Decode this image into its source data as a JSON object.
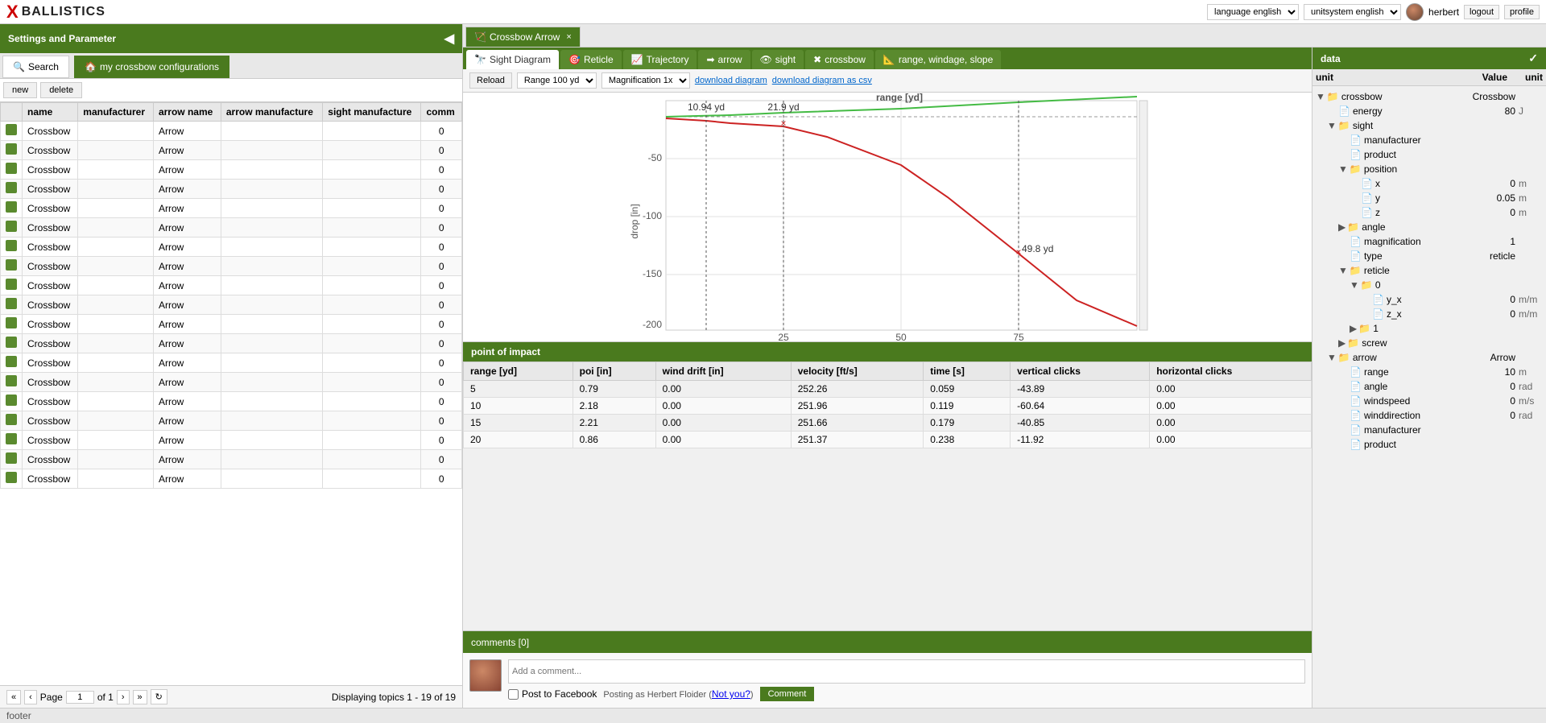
{
  "header": {
    "logo_x": "X",
    "logo_text": "BALLISTICS",
    "language_label": "language english",
    "unitsystem_label": "unitsystem english",
    "user": "herbert",
    "logout": "logout",
    "profile": "profile"
  },
  "left_panel": {
    "title": "Settings and Parameter",
    "collapse_icon": "◀",
    "tabs": [
      {
        "id": "search",
        "label": "Search",
        "icon": "🔍"
      },
      {
        "id": "my_configs",
        "label": "my crossbow configurations",
        "icon": "🏠"
      }
    ],
    "toolbar": {
      "new": "new",
      "delete": "delete"
    },
    "table": {
      "columns": [
        "name",
        "manufacturer",
        "arrow name",
        "arrow manufacture",
        "sight manufacture",
        "comm"
      ],
      "rows": [
        {
          "name": "Crossbow",
          "manufacturer": "",
          "arrow_name": "Arrow",
          "arrow_mfr": "",
          "sight_mfr": "",
          "comm": "0"
        },
        {
          "name": "Crossbow",
          "manufacturer": "",
          "arrow_name": "Arrow",
          "arrow_mfr": "",
          "sight_mfr": "",
          "comm": "0"
        },
        {
          "name": "Crossbow",
          "manufacturer": "",
          "arrow_name": "Arrow",
          "arrow_mfr": "",
          "sight_mfr": "",
          "comm": "0"
        },
        {
          "name": "Crossbow",
          "manufacturer": "",
          "arrow_name": "Arrow",
          "arrow_mfr": "",
          "sight_mfr": "",
          "comm": "0"
        },
        {
          "name": "Crossbow",
          "manufacturer": "",
          "arrow_name": "Arrow",
          "arrow_mfr": "",
          "sight_mfr": "",
          "comm": "0"
        },
        {
          "name": "Crossbow",
          "manufacturer": "",
          "arrow_name": "Arrow",
          "arrow_mfr": "",
          "sight_mfr": "",
          "comm": "0"
        },
        {
          "name": "Crossbow",
          "manufacturer": "",
          "arrow_name": "Arrow",
          "arrow_mfr": "",
          "sight_mfr": "",
          "comm": "0"
        },
        {
          "name": "Crossbow",
          "manufacturer": "",
          "arrow_name": "Arrow",
          "arrow_mfr": "",
          "sight_mfr": "",
          "comm": "0"
        },
        {
          "name": "Crossbow",
          "manufacturer": "",
          "arrow_name": "Arrow",
          "arrow_mfr": "",
          "sight_mfr": "",
          "comm": "0"
        },
        {
          "name": "Crossbow",
          "manufacturer": "",
          "arrow_name": "Arrow",
          "arrow_mfr": "",
          "sight_mfr": "",
          "comm": "0"
        },
        {
          "name": "Crossbow",
          "manufacturer": "",
          "arrow_name": "Arrow",
          "arrow_mfr": "",
          "sight_mfr": "",
          "comm": "0"
        },
        {
          "name": "Crossbow",
          "manufacturer": "",
          "arrow_name": "Arrow",
          "arrow_mfr": "",
          "sight_mfr": "",
          "comm": "0"
        },
        {
          "name": "Crossbow",
          "manufacturer": "",
          "arrow_name": "Arrow",
          "arrow_mfr": "",
          "sight_mfr": "",
          "comm": "0"
        },
        {
          "name": "Crossbow",
          "manufacturer": "",
          "arrow_name": "Arrow",
          "arrow_mfr": "",
          "sight_mfr": "",
          "comm": "0"
        },
        {
          "name": "Crossbow",
          "manufacturer": "",
          "arrow_name": "Arrow",
          "arrow_mfr": "",
          "sight_mfr": "",
          "comm": "0"
        },
        {
          "name": "Crossbow",
          "manufacturer": "",
          "arrow_name": "Arrow",
          "arrow_mfr": "",
          "sight_mfr": "",
          "comm": "0"
        },
        {
          "name": "Crossbow",
          "manufacturer": "",
          "arrow_name": "Arrow",
          "arrow_mfr": "",
          "sight_mfr": "",
          "comm": "0"
        },
        {
          "name": "Crossbow",
          "manufacturer": "",
          "arrow_name": "Arrow",
          "arrow_mfr": "",
          "sight_mfr": "",
          "comm": "0"
        },
        {
          "name": "Crossbow",
          "manufacturer": "",
          "arrow_name": "Arrow",
          "arrow_mfr": "",
          "sight_mfr": "",
          "comm": "0"
        }
      ]
    },
    "pagination": {
      "page_label": "Page",
      "page_current": "1",
      "page_of": "of 1",
      "displaying": "Displaying topics 1 - 19 of 19"
    }
  },
  "main_tab": {
    "label": "Crossbow Arrow",
    "close": "×",
    "icon": "🏹"
  },
  "sub_tabs": [
    {
      "id": "sight_diagram",
      "label": "Sight Diagram",
      "icon": "🔭",
      "active": true
    },
    {
      "id": "reticle",
      "label": "Reticle",
      "icon": "🎯"
    },
    {
      "id": "trajectory",
      "label": "Trajectory",
      "icon": "📈"
    },
    {
      "id": "arrow",
      "label": "arrow",
      "icon": "➡"
    },
    {
      "id": "sight",
      "label": "sight",
      "icon": "👁"
    },
    {
      "id": "crossbow",
      "label": "crossbow",
      "icon": "✖"
    },
    {
      "id": "range_windage",
      "label": "range, windage, slope",
      "icon": "📐"
    }
  ],
  "diagram_controls": {
    "reload": "Reload",
    "range_label": "Range 100 yd",
    "magnification_label": "Magnification 1x",
    "download_diagram": "download diagram",
    "download_csv": "download diagram as csv"
  },
  "chart": {
    "x_label": "range [yd]",
    "y_label": "drop [in]",
    "x_ticks": [
      25,
      50,
      75
    ],
    "y_ticks": [
      -50,
      -100,
      -150,
      -200
    ],
    "annotations": [
      {
        "x": "10.94 yd",
        "y": 0
      },
      {
        "x": "21.9 yd",
        "y": 0
      },
      {
        "x": "49.8 yd",
        "y": -30
      }
    ]
  },
  "poi": {
    "title": "point of impact",
    "columns": [
      "range [yd]",
      "poi [in]",
      "wind drift [in]",
      "velocity [ft/s]",
      "time [s]",
      "vertical clicks",
      "horizontal clicks"
    ],
    "rows": [
      {
        "range": "5",
        "poi": "0.79",
        "wind_drift": "0.00",
        "velocity": "252.26",
        "time": "0.059",
        "vert_clicks": "-43.89",
        "horiz_clicks": "0.00"
      },
      {
        "range": "10",
        "poi": "2.18",
        "wind_drift": "0.00",
        "velocity": "251.96",
        "time": "0.119",
        "vert_clicks": "-60.64",
        "horiz_clicks": "0.00"
      },
      {
        "range": "15",
        "poi": "2.21",
        "wind_drift": "0.00",
        "velocity": "251.66",
        "time": "0.179",
        "vert_clicks": "-40.85",
        "horiz_clicks": "0.00"
      },
      {
        "range": "20",
        "poi": "0.86",
        "wind_drift": "0.00",
        "velocity": "251.37",
        "time": "0.238",
        "vert_clicks": "-11.92",
        "horiz_clicks": "0.00"
      }
    ]
  },
  "comments": {
    "title": "comments [0]",
    "expand_icon": "✓",
    "placeholder": "Add a comment...",
    "facebook_label": "Post to Facebook",
    "posting_as": "Posting as Herbert Floider (",
    "not_you": "Not you?",
    "posting_end": ")",
    "comment_btn": "Comment"
  },
  "data_panel": {
    "title": "data",
    "expand_icon": "✓",
    "col_unit": "unit",
    "col_value": "Value",
    "col_unit2": "unit",
    "tree": [
      {
        "type": "folder",
        "label": "crossbow",
        "value": "Crossbow",
        "unit": "",
        "indent": 0,
        "open": true
      },
      {
        "type": "file",
        "label": "energy",
        "value": "80",
        "unit": "J",
        "indent": 1
      },
      {
        "type": "folder",
        "label": "sight",
        "value": "",
        "unit": "",
        "indent": 1,
        "open": true
      },
      {
        "type": "file",
        "label": "manufacturer",
        "value": "",
        "unit": "",
        "indent": 2
      },
      {
        "type": "file",
        "label": "product",
        "value": "",
        "unit": "",
        "indent": 2
      },
      {
        "type": "folder",
        "label": "position",
        "value": "",
        "unit": "",
        "indent": 2,
        "open": true
      },
      {
        "type": "file",
        "label": "x",
        "value": "0",
        "unit": "m",
        "indent": 3
      },
      {
        "type": "file",
        "label": "y",
        "value": "0.05",
        "unit": "m",
        "indent": 3
      },
      {
        "type": "file",
        "label": "z",
        "value": "0",
        "unit": "m",
        "indent": 3
      },
      {
        "type": "folder",
        "label": "angle",
        "value": "",
        "unit": "",
        "indent": 2,
        "open": false
      },
      {
        "type": "file",
        "label": "magnification",
        "value": "1",
        "unit": "",
        "indent": 2
      },
      {
        "type": "file",
        "label": "type",
        "value": "reticle",
        "unit": "",
        "indent": 2
      },
      {
        "type": "folder",
        "label": "reticle",
        "value": "",
        "unit": "",
        "indent": 2,
        "open": true
      },
      {
        "type": "folder",
        "label": "0",
        "value": "",
        "unit": "",
        "indent": 3,
        "open": true
      },
      {
        "type": "file",
        "label": "y_x",
        "value": "0",
        "unit": "m/m",
        "indent": 4
      },
      {
        "type": "file",
        "label": "z_x",
        "value": "0",
        "unit": "m/m",
        "indent": 4
      },
      {
        "type": "folder",
        "label": "1",
        "value": "",
        "unit": "",
        "indent": 3,
        "open": false
      },
      {
        "type": "folder",
        "label": "screw",
        "value": "",
        "unit": "",
        "indent": 2,
        "open": false
      },
      {
        "type": "folder",
        "label": "arrow",
        "value": "Arrow",
        "unit": "",
        "indent": 1,
        "open": true
      },
      {
        "type": "file",
        "label": "range",
        "value": "10",
        "unit": "m",
        "indent": 2
      },
      {
        "type": "file",
        "label": "angle",
        "value": "0",
        "unit": "rad",
        "indent": 2
      },
      {
        "type": "file",
        "label": "windspeed",
        "value": "0",
        "unit": "m/s",
        "indent": 2
      },
      {
        "type": "file",
        "label": "winddirection",
        "value": "0",
        "unit": "rad",
        "indent": 2
      },
      {
        "type": "file",
        "label": "manufacturer",
        "value": "",
        "unit": "",
        "indent": 2
      },
      {
        "type": "file",
        "label": "product",
        "value": "",
        "unit": "",
        "indent": 2
      }
    ]
  },
  "footer": {
    "text": "footer"
  }
}
